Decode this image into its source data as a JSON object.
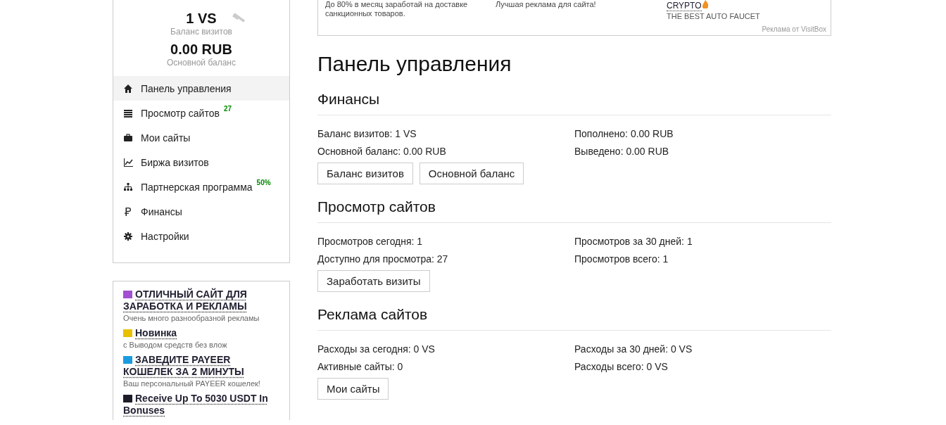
{
  "top_ad": {
    "columns": [
      {
        "text": "До 80% в месяц заработай на доставке санкционных товаров."
      },
      {
        "text": "Лучшая реклама для сайта!"
      },
      {
        "title": "CRYPTO",
        "text": "THE BEST AUTO FAUCET"
      }
    ],
    "credit": "Реклама от VisitBox"
  },
  "sidebar": {
    "balances": [
      {
        "value": "1 VS",
        "label": "Баланс визитов"
      },
      {
        "value": "0.00 RUB",
        "label": "Основной баланс"
      }
    ],
    "items": [
      {
        "label": "Панель управления",
        "selected": true
      },
      {
        "label": "Просмотр сайтов",
        "badge": "27",
        "selected": false
      },
      {
        "label": "Мои сайты",
        "selected": false
      },
      {
        "label": "Биржа визитов",
        "selected": false
      },
      {
        "label": "Партнерская программа",
        "badge": "50%",
        "selected": false
      },
      {
        "label": "Финансы",
        "selected": false
      },
      {
        "label": "Настройки",
        "selected": false
      }
    ]
  },
  "sidebar_ads": [
    {
      "title": "ОТЛИЧНЫЙ САЙТ ДЛЯ ЗАРАБОТКА И РЕКЛАМЫ",
      "text": "Очень много разнообразной рекламы",
      "color": "#a050d0"
    },
    {
      "title": "Новинка",
      "text": "с Выводом средств без влож",
      "color": "#e8c000"
    },
    {
      "title": "ЗАВЕДИТЕ PAYEER КОШЕЛЕК ЗА 2 МИНУТЫ",
      "text": "Ваш персональный PAYEER кошелек!",
      "color": "#1a9be0"
    },
    {
      "title": "Receive Up To 5030 USDT In Bonuses",
      "color": "#1c1c2a"
    }
  ],
  "page_title": "Панель управления",
  "sections": [
    {
      "title": "Финансы",
      "stats": [
        "Баланс визитов: 1 VS",
        "Пополнено: 0.00 RUB",
        "Основной баланс: 0.00 RUB",
        "Выведено: 0.00 RUB"
      ],
      "buttons": [
        "Баланс визитов",
        "Основной баланс"
      ]
    },
    {
      "title": "Просмотр сайтов",
      "stats": [
        "Просмотров сегодня: 1",
        "Просмотров за 30 дней: 1",
        "Доступно для просмотра: 27",
        "Просмотров всего: 1"
      ],
      "buttons": [
        "Заработать визиты"
      ]
    },
    {
      "title": "Реклама сайтов",
      "stats": [
        "Расходы за сегодня: 0 VS",
        "Расходы за 30 дней: 0 VS",
        "Активные сайты: 0",
        "Расходы всего: 0 VS"
      ],
      "buttons": [
        "Мои сайты"
      ]
    }
  ]
}
